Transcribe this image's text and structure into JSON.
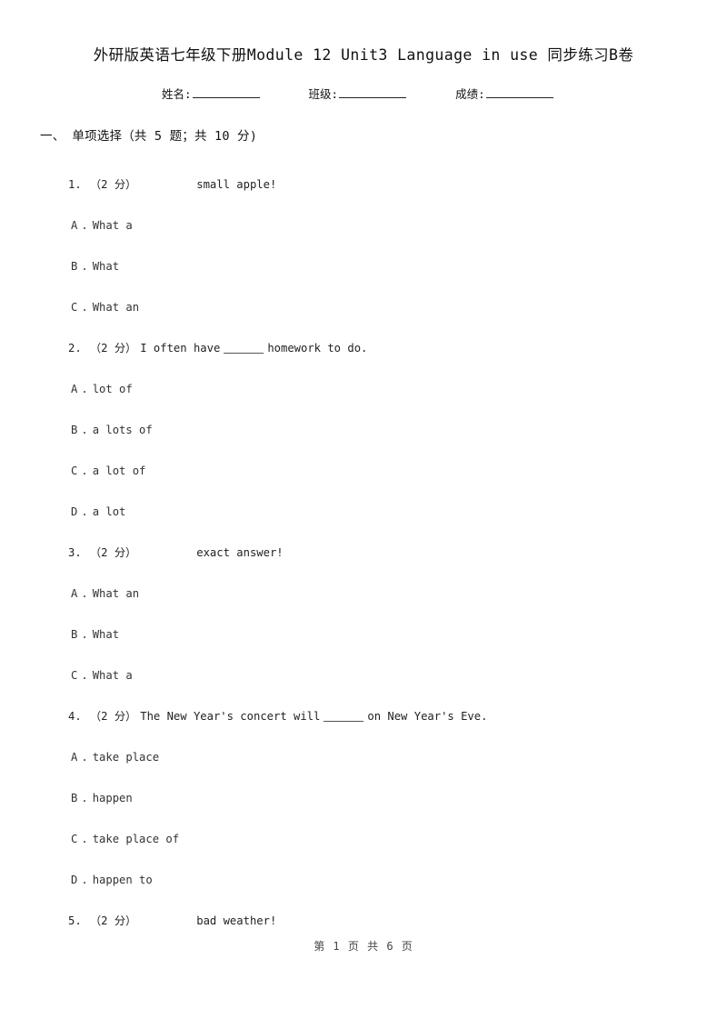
{
  "document": {
    "title": "外研版英语七年级下册Module 12 Unit3 Language in use 同步练习B卷",
    "footer": "第 1 页 共 6 页"
  },
  "student_info": {
    "name_label": "姓名:",
    "class_label": "班级:",
    "score_label": "成绩:"
  },
  "sections": [
    {
      "number": "一、",
      "title": "单项选择（共 5 题；共 10 分)"
    }
  ],
  "questions": [
    {
      "number": "1.",
      "score": "（2 分）",
      "stem_before": "",
      "has_blank": false,
      "stem_after": "small apple!",
      "gap": true,
      "options": [
        {
          "letter": "A",
          "dot": ".",
          "text": "What a"
        },
        {
          "letter": "B",
          "dot": ".",
          "text": "What"
        },
        {
          "letter": "C",
          "dot": ".",
          "text": "What an"
        }
      ]
    },
    {
      "number": "2.",
      "score": "（2 分）",
      "stem_before": "I often have",
      "has_blank": true,
      "stem_after": "homework to do.",
      "gap": false,
      "options": [
        {
          "letter": "A",
          "dot": ".",
          "text": "lot of"
        },
        {
          "letter": "B",
          "dot": ".",
          "text": "a lots of"
        },
        {
          "letter": "C",
          "dot": ".",
          "text": "a lot of"
        },
        {
          "letter": "D",
          "dot": ".",
          "text": "a lot"
        }
      ]
    },
    {
      "number": "3.",
      "score": "（2 分）",
      "stem_before": "",
      "has_blank": false,
      "stem_after": "exact answer!",
      "gap": true,
      "options": [
        {
          "letter": "A",
          "dot": ".",
          "text": "What an"
        },
        {
          "letter": "B",
          "dot": ".",
          "text": "What"
        },
        {
          "letter": "C",
          "dot": ".",
          "text": "What a"
        }
      ]
    },
    {
      "number": "4.",
      "score": "（2 分）",
      "stem_before": "The New Year's concert will",
      "has_blank": true,
      "stem_after": "on New Year's Eve.",
      "gap": false,
      "options": [
        {
          "letter": "A",
          "dot": ".",
          "text": "take place"
        },
        {
          "letter": "B",
          "dot": ".",
          "text": "happen"
        },
        {
          "letter": "C",
          "dot": ".",
          "text": "take place of"
        },
        {
          "letter": "D",
          "dot": ".",
          "text": "happen to"
        }
      ]
    },
    {
      "number": "5.",
      "score": "（2 分）",
      "stem_before": "",
      "has_blank": false,
      "stem_after": "bad weather!",
      "gap": true,
      "options": []
    }
  ]
}
